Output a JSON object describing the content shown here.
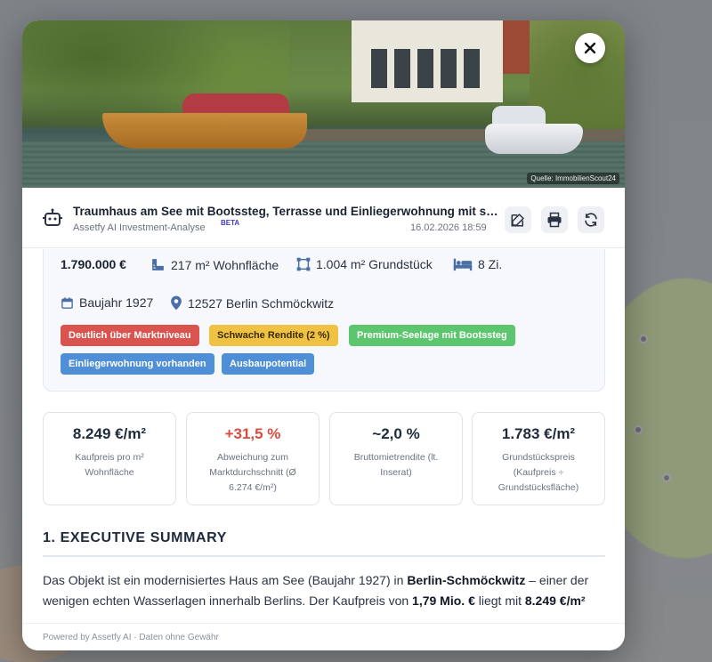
{
  "hero": {
    "credit": "Quelle: ImmobilienScout24"
  },
  "header": {
    "title": "Traumhaus am See mit Bootssteg, Terrasse und Einliegerwohnung mit se...",
    "subtitle": "Assetfy AI Investment-Analyse",
    "beta": "BETA",
    "date": "16.02.2026 18:59",
    "icons": [
      "edit-icon",
      "print-icon",
      "refresh-icon"
    ]
  },
  "facts": {
    "price": "1.790.000 €",
    "living_area": "217 m² Wohnfläche",
    "plot_area": "1.004 m² Grundstück",
    "rooms": "8 Zi.",
    "year_built": "Baujahr 1927",
    "location": "12527 Berlin Schmöckwitz"
  },
  "tags": [
    {
      "label": "Deutlich über Marktniveau",
      "color": "#d9534f"
    },
    {
      "label": "Schwache Rendite (2 %)",
      "color": "#f0c244"
    },
    {
      "label": "Premium-Seelage mit Bootssteg",
      "color": "#5cc66f"
    },
    {
      "label": "Einliegerwohnung vorhanden",
      "color": "#4f8fd8"
    },
    {
      "label": "Ausbaupotential",
      "color": "#4f8fd8"
    }
  ],
  "metrics": [
    {
      "value": "8.249 €/m²",
      "label": "Kaufpreis pro m² Wohnfläche"
    },
    {
      "value": "+31,5 %",
      "label": "Abweichung zum Marktdurchschnitt (Ø 6.274 €/m²)",
      "color": "#d94b3f"
    },
    {
      "value": "~2,0 %",
      "label": "Bruttomietrendite (lt. Inserat)"
    },
    {
      "value": "1.783 €/m²",
      "label": "Grundstückspreis (Kaufpreis ÷ Grundstücksfläche)"
    }
  ],
  "section": {
    "title": "1. EXECUTIVE SUMMARY",
    "p1_a": "Das Objekt ist ein modernisiertes Haus am See (Baujahr 1927) in ",
    "p1_b": "Berlin-Schmöckwitz",
    "p1_c": " – einer der wenigen echten Wasserlagen innerhalb Berlins. Der Kaufpreis von ",
    "p1_d": "1,79 Mio. €",
    "p1_e": " liegt mit ",
    "p1_f": "8.249 €/m²"
  },
  "footer": "Powered by Assetfy AI · Daten ohne Gewähr"
}
